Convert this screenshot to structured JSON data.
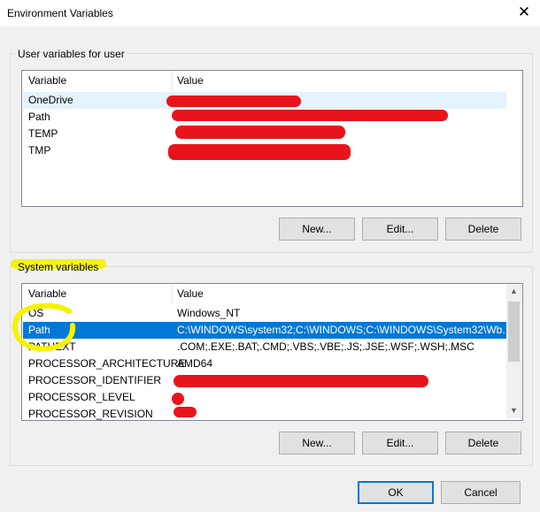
{
  "window": {
    "title": "Environment Variables",
    "close_glyph": "✕"
  },
  "user_section": {
    "label": "User variables for user",
    "columns": {
      "variable": "Variable",
      "value": "Value"
    },
    "rows": [
      {
        "name": "OneDrive",
        "value": ""
      },
      {
        "name": "Path",
        "value": ""
      },
      {
        "name": "TEMP",
        "value": ""
      },
      {
        "name": "TMP",
        "value": ""
      }
    ],
    "buttons": {
      "new": "New...",
      "edit": "Edit...",
      "delete": "Delete"
    }
  },
  "system_section": {
    "label": "System variables",
    "columns": {
      "variable": "Variable",
      "value": "Value"
    },
    "rows": [
      {
        "name": "OS",
        "value": "Windows_NT"
      },
      {
        "name": "Path",
        "value": "C:\\WINDOWS\\system32;C:\\WINDOWS;C:\\WINDOWS\\System32\\Wb..."
      },
      {
        "name": "PATHEXT",
        "value": ".COM;.EXE;.BAT;.CMD;.VBS;.VBE;.JS;.JSE;.WSF;.WSH;.MSC"
      },
      {
        "name": "PROCESSOR_ARCHITECTURE",
        "value": "AMD64"
      },
      {
        "name": "PROCESSOR_IDENTIFIER",
        "value": ""
      },
      {
        "name": "PROCESSOR_LEVEL",
        "value": ""
      },
      {
        "name": "PROCESSOR_REVISION",
        "value": ""
      }
    ],
    "selected_row": "Path",
    "buttons": {
      "new": "New...",
      "edit": "Edit...",
      "delete": "Delete"
    }
  },
  "dialog_buttons": {
    "ok": "OK",
    "cancel": "Cancel"
  },
  "colors": {
    "selection": "#0078d7",
    "redaction": "#e8141c",
    "highlighter": "#f6f200"
  },
  "icons": {
    "scroll_up": "chevron-up-icon",
    "scroll_down": "chevron-down-icon"
  }
}
